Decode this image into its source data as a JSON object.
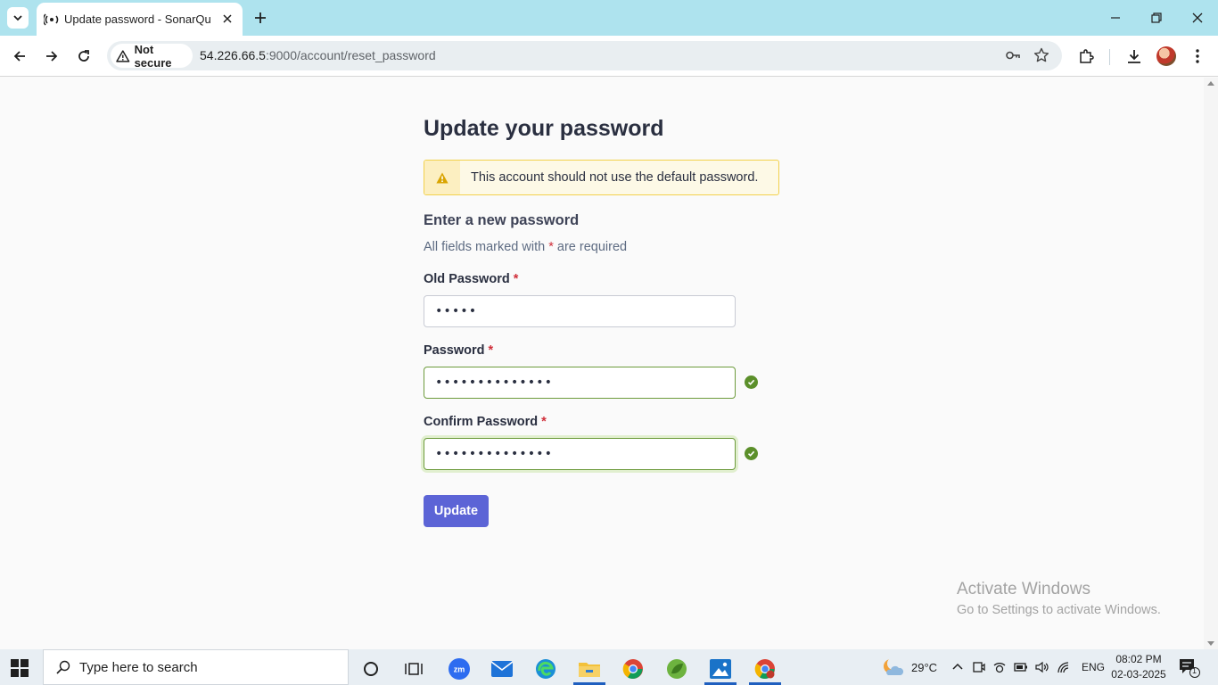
{
  "browser": {
    "tab_title": "Update password - SonarQube",
    "security_label": "Not secure",
    "url_host": "54.226.66.5",
    "url_rest": ":9000/account/reset_password"
  },
  "form": {
    "title": "Update your password",
    "warning": "This account should not use the default password.",
    "subheading": "Enter a new password",
    "required_prefix": "All fields marked with",
    "required_star": "*",
    "required_suffix": "are required",
    "old_password_label": "Old Password",
    "old_password_value": "•••••",
    "password_label": "Password",
    "password_value": "••••••••••••••",
    "confirm_label": "Confirm Password",
    "confirm_value": "••••••••••••••",
    "star": "*",
    "update_label": "Update"
  },
  "watermark": {
    "title": "Activate Windows",
    "subtitle": "Go to Settings to activate Windows."
  },
  "taskbar": {
    "search_placeholder": "Type here to search",
    "weather": "29°C",
    "language": "ENG",
    "time": "08:02 PM",
    "date": "02-03-2025",
    "notification_count": "1"
  },
  "colors": {
    "tab_strip": "#aee3ee",
    "primary_button": "#5c64d6",
    "valid_green": "#5b8f2a",
    "warning_border": "#f2d14c",
    "required_star": "#d02f3a"
  }
}
